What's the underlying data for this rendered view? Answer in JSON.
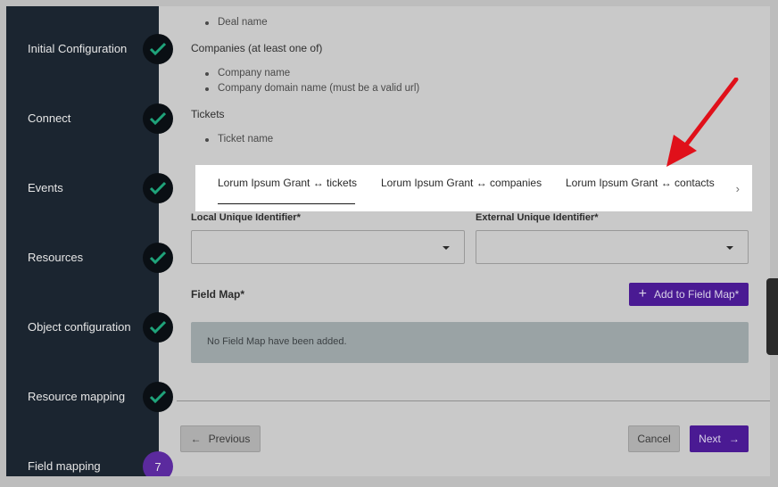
{
  "steps": [
    {
      "label": "Initial Configuration",
      "status": "done"
    },
    {
      "label": "Connect",
      "status": "done"
    },
    {
      "label": "Events",
      "status": "done"
    },
    {
      "label": "Resources",
      "status": "done"
    },
    {
      "label": "Object configuration",
      "status": "done"
    },
    {
      "label": "Resource mapping",
      "status": "done"
    },
    {
      "label": "Field mapping",
      "status": "current",
      "number": "7"
    }
  ],
  "requirements": {
    "deal_item": "Deal name",
    "companies_heading": "Companies (at least one of)",
    "companies_items": [
      "Company name",
      "Company domain name (must be a valid url)"
    ],
    "tickets_heading": "Tickets",
    "tickets_item": "Ticket name"
  },
  "tabs": [
    {
      "label": "Lorum Ipsum Grant ↔ tickets",
      "active": true
    },
    {
      "label": "Lorum Ipsum Grant ↔ companies",
      "active": false
    },
    {
      "label": "Lorum Ipsum Grant ↔ contacts",
      "active": false
    }
  ],
  "tabs_scroll_icon": "chevron-right-icon",
  "local_uid": {
    "label": "Local Unique Identifier",
    "required_mark": "*",
    "value": ""
  },
  "external_uid": {
    "label": "External Unique Identifier",
    "required_mark": "*",
    "value": ""
  },
  "field_map": {
    "label": "Field Map*",
    "add_button": "Add to Field Map*",
    "empty_text": "No Field Map have been added."
  },
  "footer": {
    "previous": "Previous",
    "cancel": "Cancel",
    "next": "Next"
  },
  "colors": {
    "sidebar": "#1b2530",
    "accent": "#4a1a93",
    "check": "#1fa37a",
    "annotation_arrow": "#e0101a"
  }
}
